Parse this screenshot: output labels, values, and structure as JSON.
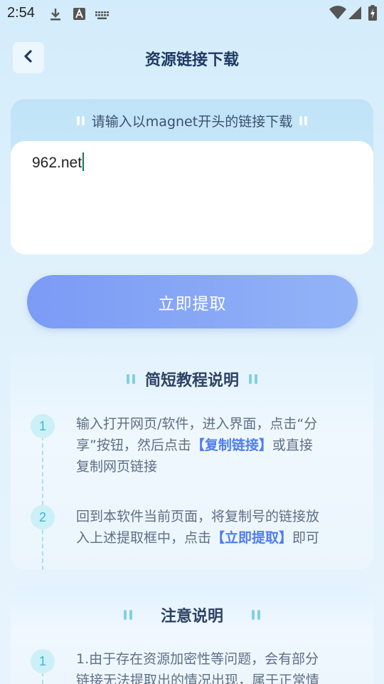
{
  "status_bar": {
    "time": "2:54"
  },
  "header": {
    "title": "资源链接下载"
  },
  "input_card": {
    "hint": "请输入以magnet开头的链接下载",
    "value": "962.net"
  },
  "extract_button": {
    "label": "立即提取"
  },
  "tutorial": {
    "title": "简短教程说明",
    "steps": [
      {
        "num": "1",
        "line1": "输入打开网页/软件，进入界面，点击“分",
        "line2_pre": "享”按钮，然后点击",
        "line2_hl": "【复制链接】",
        "line2_post": "或直接",
        "line3": "复制网页链接"
      },
      {
        "num": "2",
        "line1": "回到本软件当前页面，将复制号的链接放",
        "line2_pre": "入上述提取框中，点击",
        "line2_hl": "【立即提取】",
        "line2_post": "即可"
      }
    ]
  },
  "notice": {
    "title": "注意说明",
    "items": [
      {
        "num": "1",
        "line1": "1.由于存在资源加密性等问题，会有部分",
        "line2": "链接无法提取出的情况出现，属于正常情"
      }
    ]
  },
  "colors": {
    "accent": "#7b9bf6",
    "highlight": "#4f7cf0",
    "step_bg": "#ccf0f7",
    "step_fg": "#3cb6d4"
  },
  "icons": [
    "download-icon",
    "text-a-icon",
    "keyboard-icon",
    "wifi-icon",
    "signal-icon",
    "battery-icon",
    "back-chevron-icon"
  ]
}
